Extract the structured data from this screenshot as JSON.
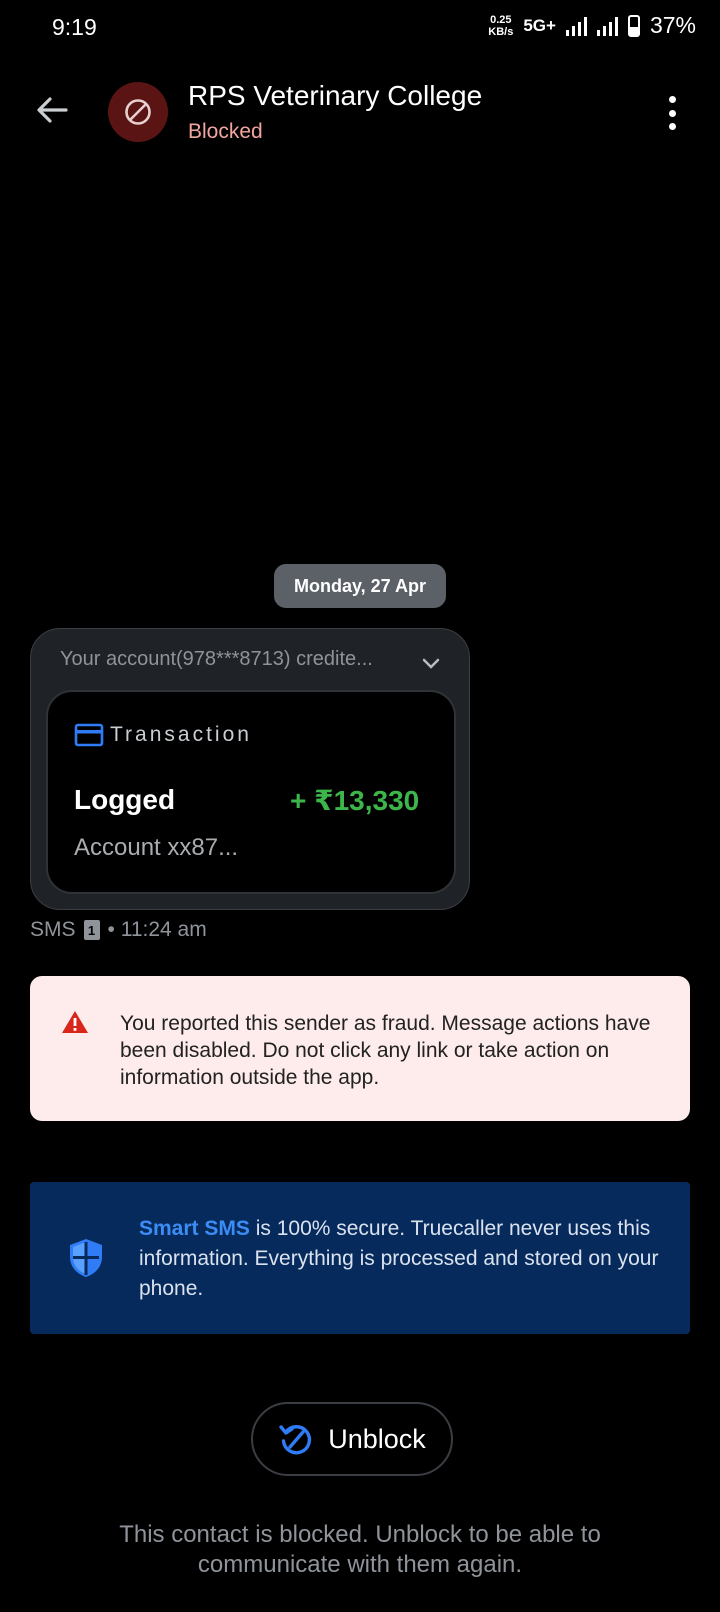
{
  "status_bar": {
    "time": "9:19",
    "speed_value": "0.25",
    "speed_unit": "KB/s",
    "network": "5G+",
    "battery": "37%"
  },
  "header": {
    "title": "RPS Veterinary College",
    "subtitle": "Blocked",
    "back_icon": "arrow-left-icon",
    "avatar_icon": "block-icon",
    "menu_icon": "more-vert-icon"
  },
  "conversation": {
    "date": "Monday, 27 Apr",
    "message": {
      "preview": "Your account(978***8713) credite...",
      "card_label": "Transaction",
      "status": "Logged",
      "amount": "+ ₹13,330",
      "account": "Account xx87...",
      "channel": "SMS",
      "sim": "1",
      "time": "• 11:24 am"
    }
  },
  "fraud_notice": {
    "text": "You reported this sender as fraud. Message actions have been disabled. Do not click any link or take action on information outside the app."
  },
  "secure_notice": {
    "brand": "Smart SMS",
    "text": " is 100% secure. Truecaller never uses this information. Everything is processed and stored on your phone."
  },
  "unblock": {
    "label": "Unblock",
    "footer": "This contact is blocked. Unblock to be able to communicate with them again."
  },
  "colors": {
    "background": "#000000",
    "blocked_red": "#f2a59e",
    "amount_green": "#3cb54a",
    "smart_blue": "#3b8df5",
    "secure_bg": "#072a5c",
    "warning_bg": "#fdeceb"
  }
}
